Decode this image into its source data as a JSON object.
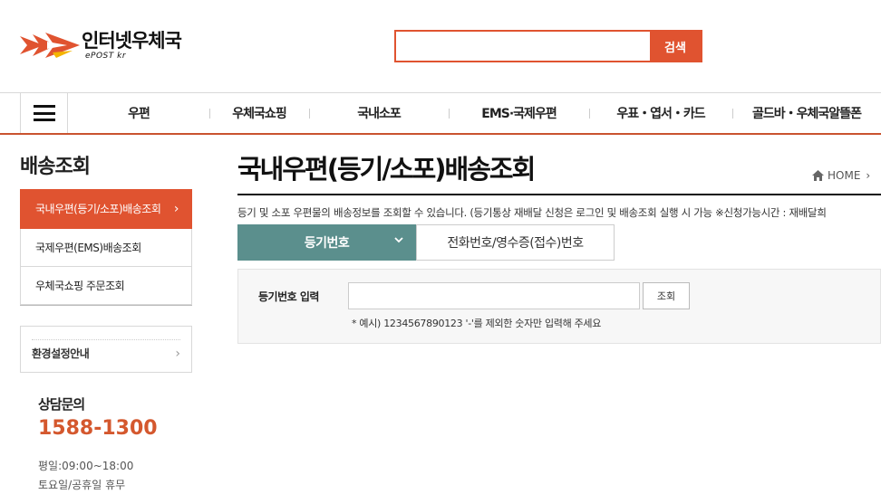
{
  "header": {
    "logo_title": "인터넷우체국",
    "logo_sub": "ePOST kr",
    "search_value": "",
    "search_button": "검색"
  },
  "gnb": {
    "items": [
      "우편",
      "우체국쇼핑",
      "국내소포",
      "EMS·국제우편",
      "우표・엽서・카드",
      "골드바・우체국알뜰폰"
    ]
  },
  "lnb": {
    "title": "배송조회",
    "items": [
      "국내우편(등기/소포)배송조회",
      "국제우편(EMS)배송조회",
      "우체국쇼핑 주문조회"
    ],
    "env_label": "환경설정안내",
    "cs_title": "상담문의",
    "cs_phone": "1588-1300",
    "cs_hours": [
      "평일:09:00~18:00",
      "토요일/공휴일 휴무"
    ]
  },
  "main": {
    "title": "국내우편(등기/소포)배송조회",
    "breadcrumb_home": "HOME",
    "description": "등기 및 소포 우편물의 배송정보를 조회할 수 있습니다. (등기통상 재배달 신청은 로그인 및 배송조회 실행 시 가능 ※신청가능시간 : 재배달희",
    "tabs": [
      "등기번호",
      "전화번호/영수증(접수)번호"
    ],
    "form_label": "등기번호 입력",
    "input_value": "",
    "query_button": "조회",
    "hint": "* 예시) 1234567890123 '-'를 제외한 숫자만 입력해 주세요"
  },
  "colors": {
    "brand": "#e05330",
    "tab_active": "#5b8f8d",
    "phone": "#d4582e"
  },
  "icons": [
    "hamburger-menu-icon",
    "chevron-right-icon",
    "home-icon",
    "chevron-down-icon"
  ]
}
